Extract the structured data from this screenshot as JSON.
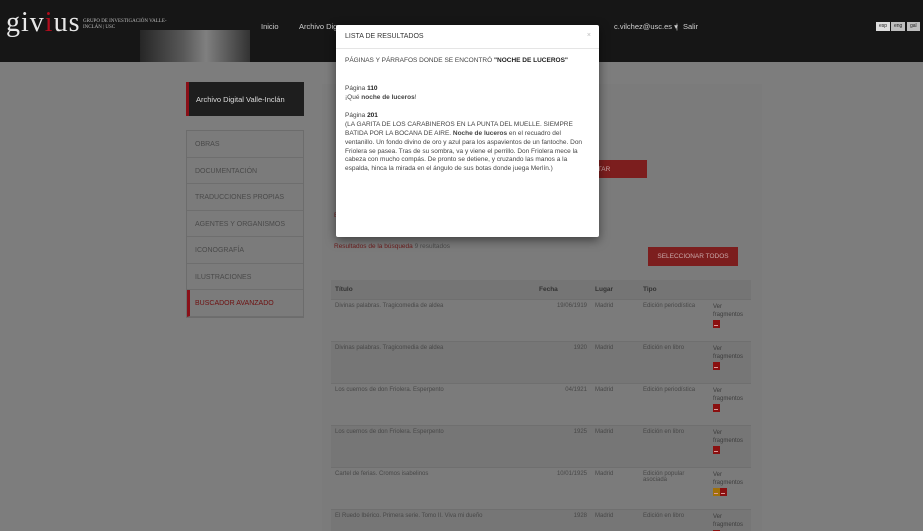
{
  "header": {
    "logo_main": "giv",
    "logo_accent": "i",
    "logo_end": "us",
    "logo_sub": "GRUPO DE INVESTIGACIÓN VALLE-INCLÁN | USC",
    "nav": [
      "Inicio",
      "Archivo Dig"
    ],
    "user": "c.vilchez@usc.es ▾",
    "separator": "|",
    "logout": "Salir",
    "langs": [
      "esp",
      "eng",
      "gal"
    ]
  },
  "sidebar": {
    "title": "Archivo Digital Valle-Inclán",
    "items": [
      "OBRAS",
      "DOCUMENTACIÓN",
      "TRADUCCIONES PROPIAS",
      "AGENTES Y ORGANISMOS",
      "ICONOGRAFÍA",
      "ILUSTRACIONES",
      "BUSCADOR AVANZADO"
    ]
  },
  "main": {
    "back_tag": "E",
    "search_button": "ITAR",
    "results_label": "Resultados de la búsqueda",
    "results_count": "9 resultados",
    "select_all": "SELECCIONAR TODOS",
    "columns": [
      "Título",
      "Fecha",
      "Lugar",
      "Tipo",
      ""
    ],
    "rows": [
      {
        "title": "Divinas palabras. Tragicomedia de aldea",
        "date": "19/06/1919",
        "place": "Madrid",
        "type": "Edición periodística",
        "action": "Ver fragmentos"
      },
      {
        "title": "Divinas palabras. Tragicomedia de aldea",
        "date": "1920",
        "place": "Madrid",
        "type": "Edición en libro",
        "action": "Ver fragmentos"
      },
      {
        "title": "Los cuernos de don Friolera. Esperpento",
        "date": "04/1921",
        "place": "Madrid",
        "type": "Edición periodística",
        "action": "Ver fragmentos"
      },
      {
        "title": "Los cuernos de don Friolera. Esperpento",
        "date": "1925",
        "place": "Madrid",
        "type": "Edición en libro",
        "action": "Ver fragmentos"
      },
      {
        "title": "Cartel de ferias. Cromos isabelinos",
        "date": "10/01/1925",
        "place": "Madrid",
        "type": "Edición popular asociada",
        "action": "Ver fragmentos"
      },
      {
        "title": "El Ruedo Ibérico. Primera serie. Tomo II. Viva mi dueño",
        "date": "1928",
        "place": "Madrid",
        "type": "Edición en libro",
        "action": "Ver fragmentos"
      }
    ]
  },
  "modal": {
    "title": "LISTA DE RESULTADOS",
    "close": "×",
    "subtitle_prefix": "PÁGINAS Y PÁRRAFOS DONDE SE ENCONTRÓ",
    "query": "\"NOCHE DE LUCEROS\"",
    "page_label": "Página",
    "hits": [
      {
        "page": "110",
        "pre": "¡Qué ",
        "match": "noche de luceros",
        "post": "!"
      },
      {
        "page": "201",
        "pre": "(LA GARITA DE LOS CARABINEROS EN LA PUNTA DEL MUELLE. SIEMPRE BATIDA POR LA BOCANA DE AIRE. ",
        "match": "Noche de luceros",
        "post": " en el recuadro del ventanillo. Un fondo divino de oro y azul para los aspavientos de un fantoche. Don Friolera se pasea. Tras de su sombra, va y viene el perrillo. Don Friolera mece la cabeza con mucho compás. De pronto se detiene, y cruzando las manos a la espalda, hinca la mirada en el ángulo de sus botas donde juega Merlín.)"
      }
    ]
  }
}
